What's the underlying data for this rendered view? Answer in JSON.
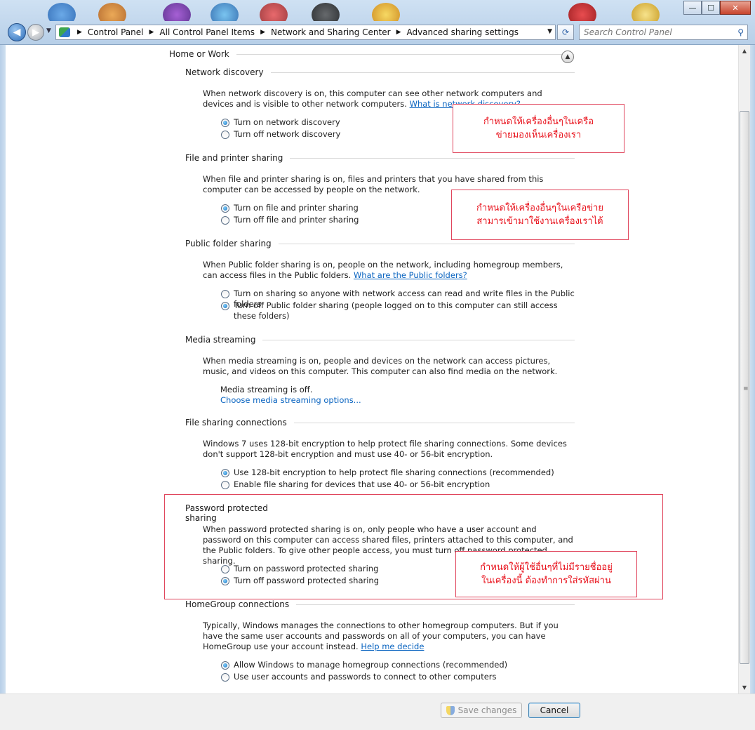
{
  "window": {
    "minimize_glyph": "—",
    "maximize_glyph": "☐",
    "close_glyph": "✕"
  },
  "nav": {
    "back_glyph": "◀",
    "forward_glyph": "▶",
    "history_glyph": "▼",
    "breadcrumbs": [
      "Control Panel",
      "All Control Panel Items",
      "Network and Sharing Center",
      "Advanced sharing settings"
    ],
    "breadcrumb_sep": "▶",
    "dropdown_glyph": "▼",
    "refresh_glyph": "⟳",
    "search_placeholder": "Search Control Panel",
    "search_glyph": "⚲"
  },
  "profile": {
    "title": "Home or Work",
    "collapse_glyph": "▲"
  },
  "sections": {
    "network_discovery": {
      "title": "Network discovery",
      "desc": "When network discovery is on, this computer can see other network computers and devices and is visible to other network computers.",
      "link": "What is network discovery?",
      "options": [
        "Turn on network discovery",
        "Turn off network discovery"
      ],
      "selected": 0
    },
    "file_printer": {
      "title": "File and printer sharing",
      "desc": "When file and printer sharing is on, files and printers that you have shared from this computer can be accessed by people on the network.",
      "options": [
        "Turn on file and printer sharing",
        "Turn off file and printer sharing"
      ],
      "selected": 0
    },
    "public_folder": {
      "title": "Public folder sharing",
      "desc": "When Public folder sharing is on, people on the network, including homegroup members, can access files in the Public folders.",
      "link": "What are the Public folders?",
      "options": [
        "Turn on sharing so anyone with network access can read and write files in the Public folders",
        "Turn off Public folder sharing (people logged on to this computer can still access these folders)"
      ],
      "selected": 1
    },
    "media_streaming": {
      "title": "Media streaming",
      "desc": "When media streaming is on, people and devices on the network can access pictures, music, and videos on this computer. This computer can also find media on the network.",
      "status": "Media streaming is off.",
      "link": "Choose media streaming options..."
    },
    "file_sharing_conn": {
      "title": "File sharing connections",
      "desc": "Windows 7 uses 128-bit encryption to help protect file sharing connections. Some devices don't support 128-bit encryption and must use 40- or 56-bit encryption.",
      "options": [
        "Use 128-bit encryption to help protect file sharing connections (recommended)",
        "Enable file sharing for devices that use 40- or 56-bit encryption"
      ],
      "selected": 0
    },
    "password_sharing": {
      "title": "Password protected sharing",
      "desc": "When password protected sharing is on, only people who have a user account and password on this computer can access shared files, printers attached to this computer, and the Public folders. To give other people access, you must turn off password protected sharing.",
      "options": [
        "Turn on password protected sharing",
        "Turn off password protected sharing"
      ],
      "selected": 1
    },
    "homegroup": {
      "title": "HomeGroup connections",
      "desc": "Typically, Windows manages the connections to other homegroup computers. But if you have the same user accounts and passwords on all of your computers, you can have HomeGroup use your account instead.",
      "link": "Help me decide",
      "options": [
        "Allow Windows to manage homegroup connections (recommended)",
        "Use user accounts and passwords to connect to other computers"
      ],
      "selected": 0
    }
  },
  "annotations": {
    "discovery_note": [
      "กำหนดให้เครื่องอื่นๆในเครือ",
      "ข่ายมองเห็นเครื่องเรา"
    ],
    "sharing_note": [
      "กำหนดให้เครื่องอื่นๆในเครือข่าย",
      "สามารเข้ามาใช้งานเครื่องเราได้"
    ],
    "password_note": [
      "กำหนดให้ผู้ใช้อื่นๆที่ไม่มีรายชื่ออยู่",
      "ในเครื่องนี้ ต้องทำการใส่รหัสผ่าน"
    ],
    "color": "#e8101a"
  },
  "footer": {
    "save_label": "Save changes",
    "cancel_label": "Cancel"
  },
  "scroll": {
    "up_glyph": "▲",
    "down_glyph": "▼",
    "grip_glyph": "≡"
  }
}
